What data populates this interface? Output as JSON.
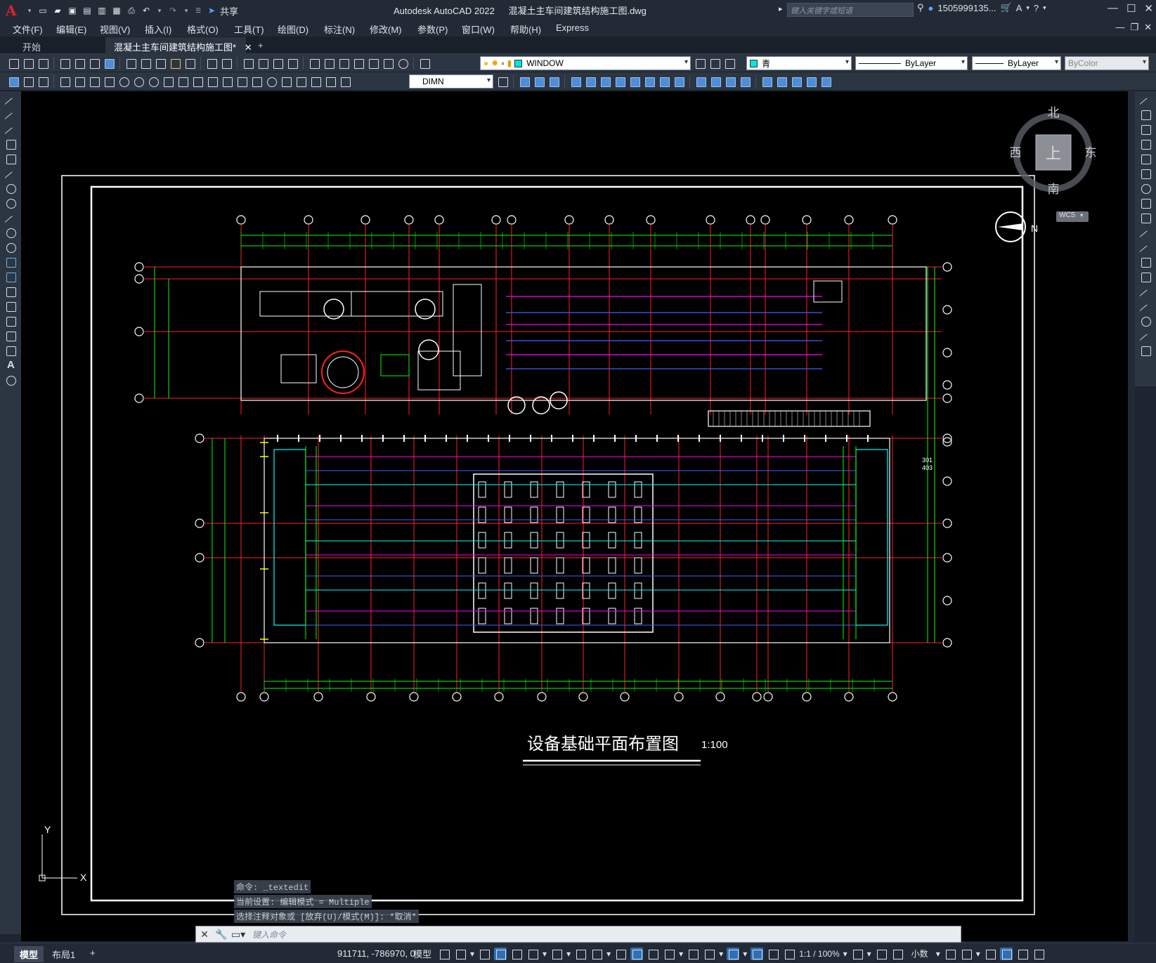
{
  "app": {
    "logo": "A",
    "product": "Autodesk AutoCAD 2022",
    "document": "混凝土主车间建筑结构施工图.dwg",
    "search_placeholder": "键入关键字或短语",
    "user": "1505999135...",
    "share": "共享"
  },
  "menu": [
    "文件(F)",
    "编辑(E)",
    "视图(V)",
    "插入(I)",
    "格式(O)",
    "工具(T)",
    "绘图(D)",
    "标注(N)",
    "修改(M)",
    "参数(P)",
    "窗口(W)",
    "帮助(H)",
    "Express"
  ],
  "tabs": {
    "start": "开始",
    "drawing": "混凝土主车间建筑结构施工图*",
    "close": "✕",
    "add": "+"
  },
  "toolbar": {
    "layer_state": "WINDOW",
    "color": "青",
    "color_hex": "#00e5e5",
    "linetype": "ByLayer",
    "lineweight": "ByLayer",
    "plotstyle": "ByColor",
    "dimstyle": "DIMN"
  },
  "compass": {
    "north": "北",
    "south": "南",
    "east": "东",
    "west": "西",
    "top": "上",
    "ucs": "WCS"
  },
  "drawing": {
    "title": "设备基础平面布置图",
    "scale": "1:100",
    "north_label": "N",
    "ucs_y": "Y",
    "ucs_x": "X",
    "note_301": "301",
    "note_403": "403"
  },
  "command": {
    "history": [
      "命令: _textedit",
      "当前设置: 编辑模式 = Multiple",
      "选择注释对象或 [放弃(U)/模式(M)]: *取消*"
    ],
    "placeholder": "键入命令"
  },
  "status": {
    "model_tab": "模型",
    "layout_tab": "布局1",
    "add": "+",
    "coords": "911711, -786970, 0",
    "model": "模型",
    "scale": "1:1 / 100%",
    "units": "小数"
  },
  "colors": {
    "red": "#ff2020",
    "green": "#00ff00",
    "cyan": "#00ffff",
    "magenta": "#ff00ff",
    "white": "#ffffff",
    "yellow": "#ffff00",
    "blue": "#4060ff"
  }
}
